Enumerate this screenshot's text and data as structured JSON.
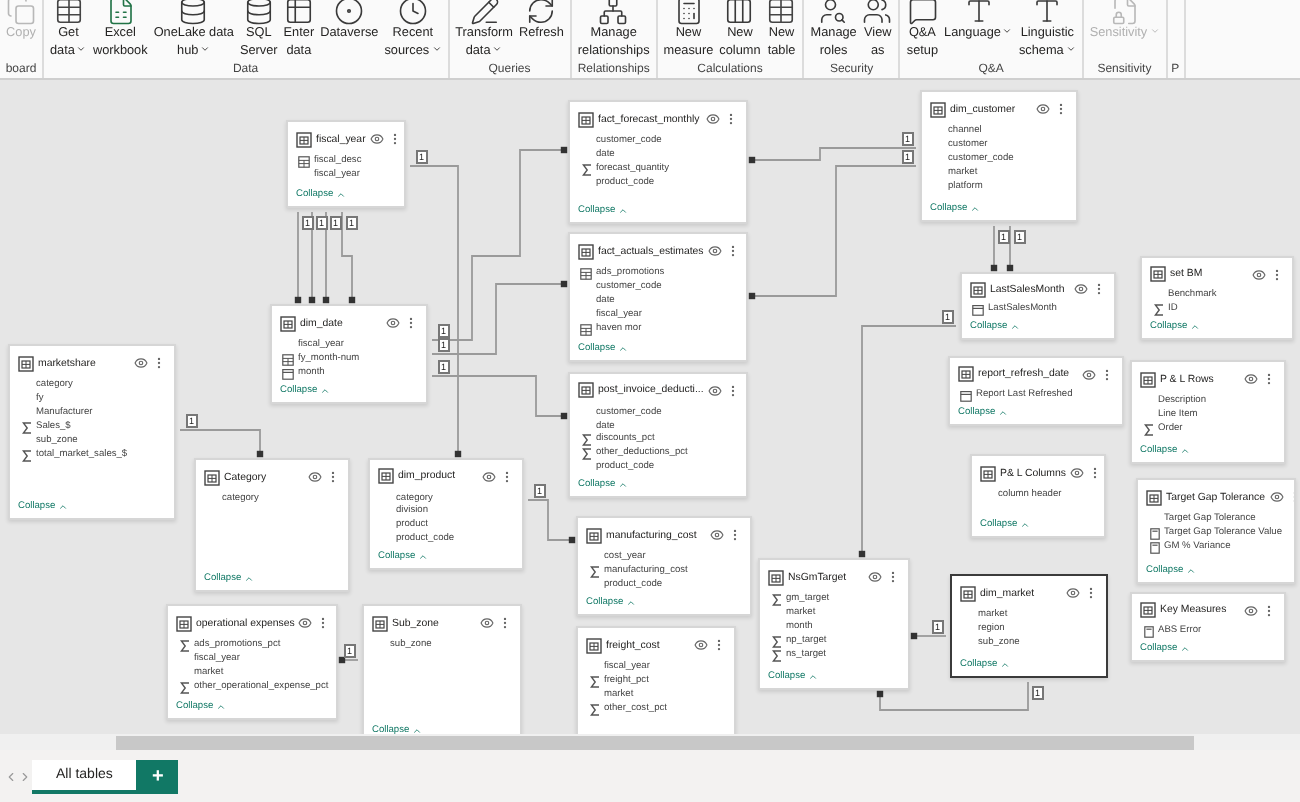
{
  "ribbon": {
    "groups": [
      {
        "label": "board",
        "buttons": [
          {
            "lines": [
              "Copy"
            ],
            "dropdown": false,
            "disabled": true
          }
        ]
      },
      {
        "label": "Data",
        "buttons": [
          {
            "lines": [
              "Get",
              "data"
            ],
            "dropdown": true,
            "disabled": false
          },
          {
            "lines": [
              "Excel",
              "workbook"
            ],
            "dropdown": false,
            "disabled": false
          },
          {
            "lines": [
              "OneLake data",
              "hub"
            ],
            "dropdown": true,
            "disabled": false
          },
          {
            "lines": [
              "SQL",
              "Server"
            ],
            "dropdown": false,
            "disabled": false
          },
          {
            "lines": [
              "Enter",
              "data"
            ],
            "dropdown": false,
            "disabled": false
          },
          {
            "lines": [
              "Dataverse"
            ],
            "dropdown": false,
            "disabled": false
          },
          {
            "lines": [
              "Recent",
              "sources"
            ],
            "dropdown": true,
            "disabled": false
          }
        ]
      },
      {
        "label": "Queries",
        "buttons": [
          {
            "lines": [
              "Transform",
              "data"
            ],
            "dropdown": true,
            "disabled": false
          },
          {
            "lines": [
              "Refresh"
            ],
            "dropdown": false,
            "disabled": false
          }
        ]
      },
      {
        "label": "Relationships",
        "buttons": [
          {
            "lines": [
              "Manage",
              "relationships"
            ],
            "dropdown": false,
            "disabled": false
          }
        ]
      },
      {
        "label": "Calculations",
        "buttons": [
          {
            "lines": [
              "New",
              "measure"
            ],
            "dropdown": false,
            "disabled": false
          },
          {
            "lines": [
              "New",
              "column"
            ],
            "dropdown": false,
            "disabled": false
          },
          {
            "lines": [
              "New",
              "table"
            ],
            "dropdown": false,
            "disabled": false
          }
        ]
      },
      {
        "label": "Security",
        "buttons": [
          {
            "lines": [
              "Manage",
              "roles"
            ],
            "dropdown": false,
            "disabled": false
          },
          {
            "lines": [
              "View",
              "as"
            ],
            "dropdown": false,
            "disabled": false
          }
        ]
      },
      {
        "label": "Q&A",
        "buttons": [
          {
            "lines": [
              "Q&A",
              "setup"
            ],
            "dropdown": false,
            "disabled": false
          },
          {
            "lines": [
              "Language"
            ],
            "dropdown": true,
            "disabled": false
          },
          {
            "lines": [
              "Linguistic",
              "schema"
            ],
            "dropdown": true,
            "disabled": false
          }
        ]
      },
      {
        "label": "Sensitivity",
        "buttons": [
          {
            "lines": [
              "Sensitivity"
            ],
            "dropdown": true,
            "disabled": true
          }
        ]
      },
      {
        "label": "P"
      }
    ]
  },
  "tables": [
    {
      "name": "fiscal_year",
      "selected": false,
      "fields": [
        {
          "name": "fiscal_desc",
          "kind": "hierarchy"
        },
        {
          "name": "fiscal_year",
          "kind": "column"
        }
      ],
      "collapse": "Collapse"
    },
    {
      "name": "fact_forecast_monthly",
      "selected": false,
      "fields": [
        {
          "name": "customer_code",
          "kind": "column"
        },
        {
          "name": "date",
          "kind": "column"
        },
        {
          "name": "forecast_quantity",
          "kind": "sum"
        },
        {
          "name": "product_code",
          "kind": "column"
        }
      ],
      "collapse": "Collapse"
    },
    {
      "name": "dim_customer",
      "selected": false,
      "fields": [
        {
          "name": "channel",
          "kind": "column"
        },
        {
          "name": "customer",
          "kind": "column"
        },
        {
          "name": "customer_code",
          "kind": "column"
        },
        {
          "name": "market",
          "kind": "column"
        },
        {
          "name": "platform",
          "kind": "column"
        }
      ],
      "collapse": "Collapse"
    },
    {
      "name": "fact_actuals_estimates",
      "selected": false,
      "fields": [
        {
          "name": "ads_promotions",
          "kind": "hierarchy"
        },
        {
          "name": "customer_code",
          "kind": "column"
        },
        {
          "name": "date",
          "kind": "column"
        },
        {
          "name": "fiscal_year",
          "kind": "column"
        },
        {
          "name": "haven mor",
          "kind": "hierarchy"
        }
      ],
      "collapse": "Collapse"
    },
    {
      "name": "LastSalesMonth",
      "selected": false,
      "fields": [
        {
          "name": "LastSalesMonth",
          "kind": "calendar"
        }
      ],
      "collapse": "Collapse"
    },
    {
      "name": "set BM",
      "selected": false,
      "fields": [
        {
          "name": "Benchmark",
          "kind": "column"
        },
        {
          "name": "ID",
          "kind": "sum"
        }
      ],
      "collapse": "Collapse"
    },
    {
      "name": "dim_date",
      "selected": false,
      "fields": [
        {
          "name": "fiscal_year",
          "kind": "column"
        },
        {
          "name": "fy_month-num",
          "kind": "hierarchy"
        },
        {
          "name": "month",
          "kind": "calendar"
        }
      ],
      "collapse": "Collapse"
    },
    {
      "name": "marketshare",
      "selected": false,
      "fields": [
        {
          "name": "category",
          "kind": "column"
        },
        {
          "name": "fy",
          "kind": "column"
        },
        {
          "name": "Manufacturer",
          "kind": "column"
        },
        {
          "name": "Sales_$",
          "kind": "sum"
        },
        {
          "name": "sub_zone",
          "kind": "column"
        },
        {
          "name": "total_market_sales_$",
          "kind": "sum"
        }
      ],
      "collapse": "Collapse"
    },
    {
      "name": "report_refresh_date",
      "selected": false,
      "fields": [
        {
          "name": "Report Last Refreshed",
          "kind": "calendar"
        }
      ],
      "collapse": "Collapse"
    },
    {
      "name": "P & L Rows",
      "selected": false,
      "fields": [
        {
          "name": "Description",
          "kind": "column"
        },
        {
          "name": "Line Item",
          "kind": "column"
        },
        {
          "name": "Order",
          "kind": "sum"
        }
      ],
      "collapse": "Collapse"
    },
    {
      "name": "post_invoice_deducti...",
      "selected": false,
      "fields": [
        {
          "name": "customer_code",
          "kind": "column"
        },
        {
          "name": "date",
          "kind": "column"
        },
        {
          "name": "discounts_pct",
          "kind": "sum"
        },
        {
          "name": "other_deductions_pct",
          "kind": "sum"
        },
        {
          "name": "product_code",
          "kind": "column"
        }
      ],
      "collapse": "Collapse"
    },
    {
      "name": "Category",
      "selected": false,
      "fields": [
        {
          "name": "category",
          "kind": "column"
        }
      ],
      "collapse": "Collapse"
    },
    {
      "name": "dim_product",
      "selected": false,
      "fields": [
        {
          "name": "category",
          "kind": "column"
        },
        {
          "name": "division",
          "kind": "column"
        },
        {
          "name": "product",
          "kind": "column"
        },
        {
          "name": "product_code",
          "kind": "column"
        }
      ],
      "collapse": "Collapse"
    },
    {
      "name": "P& L Columns",
      "selected": false,
      "fields": [
        {
          "name": "column header",
          "kind": "column"
        }
      ],
      "collapse": "Collapse"
    },
    {
      "name": "Target Gap Tolerance",
      "selected": false,
      "fields": [
        {
          "name": "Target Gap Tolerance",
          "kind": "column"
        },
        {
          "name": "Target Gap Tolerance Value",
          "kind": "calculated"
        },
        {
          "name": "GM % Variance",
          "kind": "calculated"
        }
      ],
      "collapse": "Collapse"
    },
    {
      "name": "manufacturing_cost",
      "selected": false,
      "fields": [
        {
          "name": "cost_year",
          "kind": "column"
        },
        {
          "name": "manufacturing_cost",
          "kind": "sum"
        },
        {
          "name": "product_code",
          "kind": "column"
        }
      ],
      "collapse": "Collapse"
    },
    {
      "name": "NsGmTarget",
      "selected": false,
      "fields": [
        {
          "name": "gm_target",
          "kind": "sum"
        },
        {
          "name": "market",
          "kind": "column"
        },
        {
          "name": "month",
          "kind": "column"
        },
        {
          "name": "np_target",
          "kind": "sum"
        },
        {
          "name": "ns_target",
          "kind": "sum"
        }
      ],
      "collapse": "Collapse"
    },
    {
      "name": "dim_market",
      "selected": true,
      "fields": [
        {
          "name": "market",
          "kind": "column"
        },
        {
          "name": "region",
          "kind": "column"
        },
        {
          "name": "sub_zone",
          "kind": "column"
        }
      ],
      "collapse": "Collapse"
    },
    {
      "name": "Key Measures",
      "selected": false,
      "fields": [
        {
          "name": "ABS Error",
          "kind": "calculated"
        }
      ],
      "collapse": "Collapse"
    },
    {
      "name": "operational expenses",
      "selected": false,
      "fields": [
        {
          "name": "ads_promotions_pct",
          "kind": "sum"
        },
        {
          "name": "fiscal_year",
          "kind": "column"
        },
        {
          "name": "market",
          "kind": "column"
        },
        {
          "name": "other_operational_expense_pct",
          "kind": "sum"
        }
      ],
      "collapse": "Collapse"
    },
    {
      "name": "Sub_zone",
      "selected": false,
      "fields": [
        {
          "name": "sub_zone",
          "kind": "column"
        }
      ],
      "collapse": "Collapse"
    },
    {
      "name": "freight_cost",
      "selected": false,
      "fields": [
        {
          "name": "fiscal_year",
          "kind": "column"
        },
        {
          "name": "freight_pct",
          "kind": "sum"
        },
        {
          "name": "market",
          "kind": "column"
        },
        {
          "name": "other_cost_pct",
          "kind": "sum"
        }
      ]
    }
  ],
  "relationships": [
    {
      "label": "1"
    },
    {
      "label": "1"
    },
    {
      "label": "1"
    },
    {
      "label": "1"
    },
    {
      "label": "1"
    },
    {
      "label": "1"
    },
    {
      "label": "1"
    },
    {
      "label": "1"
    },
    {
      "label": "1"
    },
    {
      "label": "1"
    },
    {
      "label": "1"
    },
    {
      "label": "1"
    },
    {
      "label": "1"
    },
    {
      "label": "1"
    },
    {
      "label": "1"
    },
    {
      "label": "1"
    },
    {
      "label": "1"
    },
    {
      "label": "1"
    }
  ],
  "page_tabs": [
    {
      "label": "All tables",
      "selected": true
    }
  ],
  "add_tab": "+"
}
